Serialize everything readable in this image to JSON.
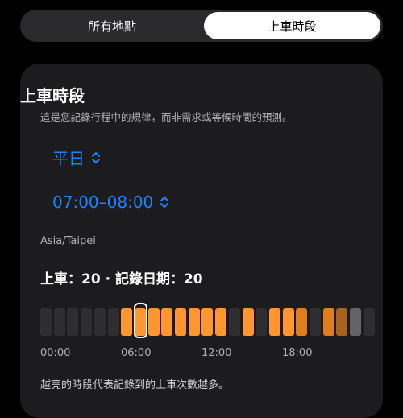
{
  "segment": {
    "left_label": "所有地點",
    "right_label": "上車時段",
    "selected": "上車時段"
  },
  "card": {
    "title": "上車時段",
    "subtitle": "這是您記錄行程中的規律，而非需求或等候時間的預測。",
    "day_picker": "平日",
    "time_picker": "07:00–08:00",
    "timezone": "Asia/Taipei",
    "stats": "上車：20 · 記錄日期：20",
    "note": "越亮的時段代表記錄到的上車次數越多。"
  },
  "colors": {
    "accent": "#1a84ff",
    "bar_empty": "#2e2e30",
    "bar_bright": "#ff9630",
    "bar_mid": "#e07d1e",
    "bar_dim": "#a8611f",
    "bar_gray": "#646466"
  },
  "chart_data": {
    "type": "heatmap",
    "x_ticks": [
      "00:00",
      "06:00",
      "12:00",
      "18:00"
    ],
    "selected_slot": 7,
    "slots": [
      {
        "level": "empty"
      },
      {
        "level": "empty"
      },
      {
        "level": "empty"
      },
      {
        "level": "empty"
      },
      {
        "level": "empty"
      },
      {
        "level": "empty"
      },
      {
        "level": "bright"
      },
      {
        "level": "bright"
      },
      {
        "level": "bright"
      },
      {
        "level": "bright"
      },
      {
        "level": "bright"
      },
      {
        "level": "bright"
      },
      {
        "level": "bright"
      },
      {
        "level": "bright"
      },
      {
        "level": "empty"
      },
      {
        "level": "bright"
      },
      {
        "level": "empty"
      },
      {
        "level": "bright"
      },
      {
        "level": "bright"
      },
      {
        "level": "mid"
      },
      {
        "level": "empty"
      },
      {
        "level": "mid"
      },
      {
        "level": "dim"
      },
      {
        "level": "gray"
      },
      {
        "level": "empty"
      }
    ]
  }
}
